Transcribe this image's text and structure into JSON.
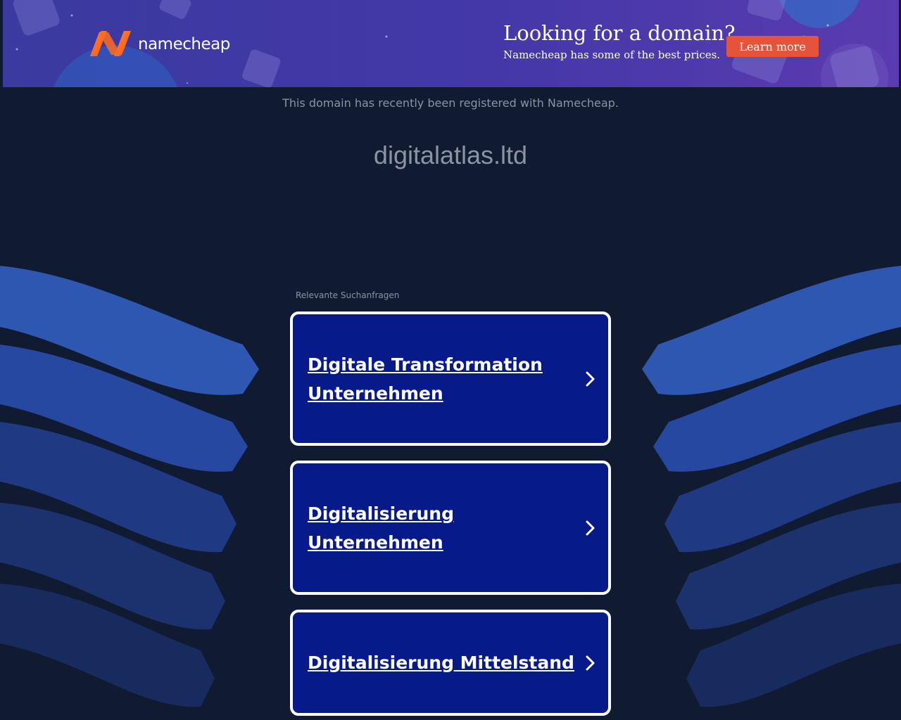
{
  "banner": {
    "brand": "namecheap",
    "promo_title": "Looking for a domain?",
    "promo_subtitle": "Namecheap has some of the best prices.",
    "cta_label": "Learn more",
    "colors": {
      "accent": "#e5533a",
      "brand_orange": "#ff6a1f",
      "banner_bg": "#4438a8"
    }
  },
  "page": {
    "registered_note": "This domain has recently been registered with Namecheap.",
    "domain": "digitalatlas.ltd",
    "colors": {
      "background": "#101a30",
      "card_bg": "#071a8a"
    }
  },
  "related": {
    "label": "Relevante Suchanfragen",
    "items": [
      {
        "label": "Digitale Transformation Unternehmen",
        "icon": "chevron-right-icon"
      },
      {
        "label": "Digitalisierung Unternehmen",
        "icon": "chevron-right-icon"
      },
      {
        "label": "Digitalisierung Mittelstand",
        "icon": "chevron-right-icon"
      }
    ]
  }
}
